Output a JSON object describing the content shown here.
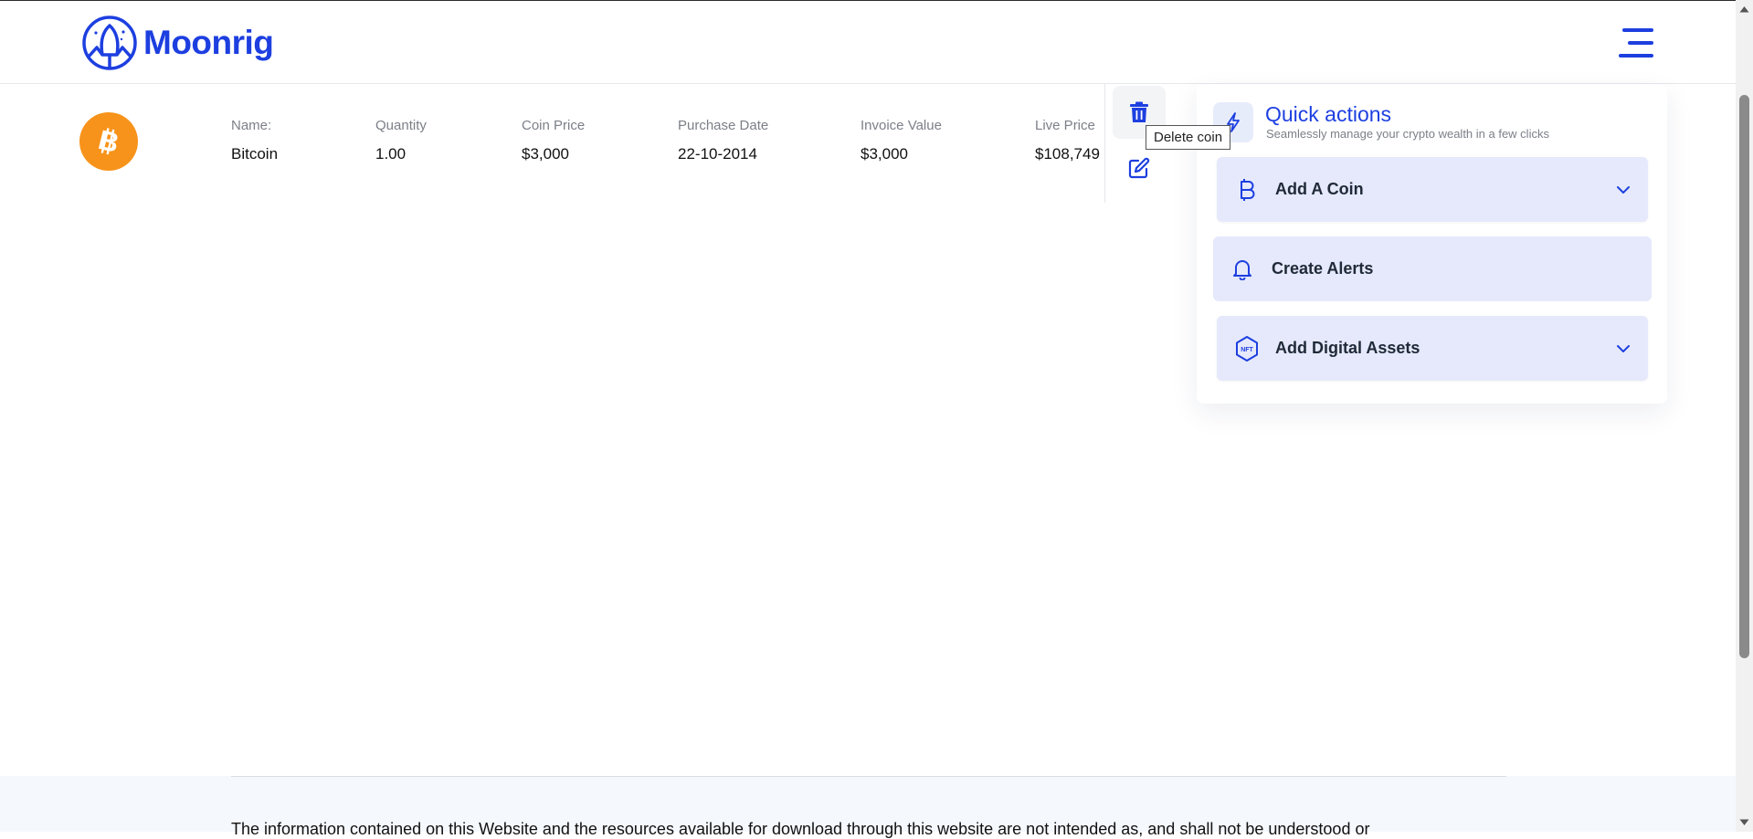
{
  "header": {
    "brand": "Moonrig",
    "logo_icon": "moonrig-rocket-logo",
    "menu_icon": "hamburger-menu-icon",
    "accent_color": "#1d3fe0"
  },
  "coin": {
    "icon": "bitcoin-icon",
    "icon_color": "#f7931a",
    "columns": [
      {
        "label": "Name:",
        "value": "Bitcoin"
      },
      {
        "label": "Quantity",
        "value": "1.00"
      },
      {
        "label": "Coin Price",
        "value": "$3,000"
      },
      {
        "label": "Purchase Date",
        "value": "22-10-2014"
      },
      {
        "label": "Invoice Value",
        "value": "$3,000"
      },
      {
        "label": "Live Price",
        "value": "$108,749"
      }
    ],
    "delete_icon": "trash-icon",
    "edit_icon": "edit-icon",
    "tooltip": "Delete coin"
  },
  "quick_actions": {
    "title": "Quick actions",
    "subtitle": "Seamlessly manage your crypto wealth in a few clicks",
    "icon": "lightning-icon",
    "items": [
      {
        "label": "Add A Coin",
        "icon": "bitcoin-b-icon",
        "expandable": true
      },
      {
        "label": "Create Alerts",
        "icon": "bell-icon",
        "expandable": false
      },
      {
        "label": "Add Digital Assets",
        "icon": "nft-icon",
        "expandable": true
      }
    ]
  },
  "footer": {
    "disclaimer": "The information contained on this Website and the resources available for download through this website are not intended as, and shall not be understood or"
  }
}
